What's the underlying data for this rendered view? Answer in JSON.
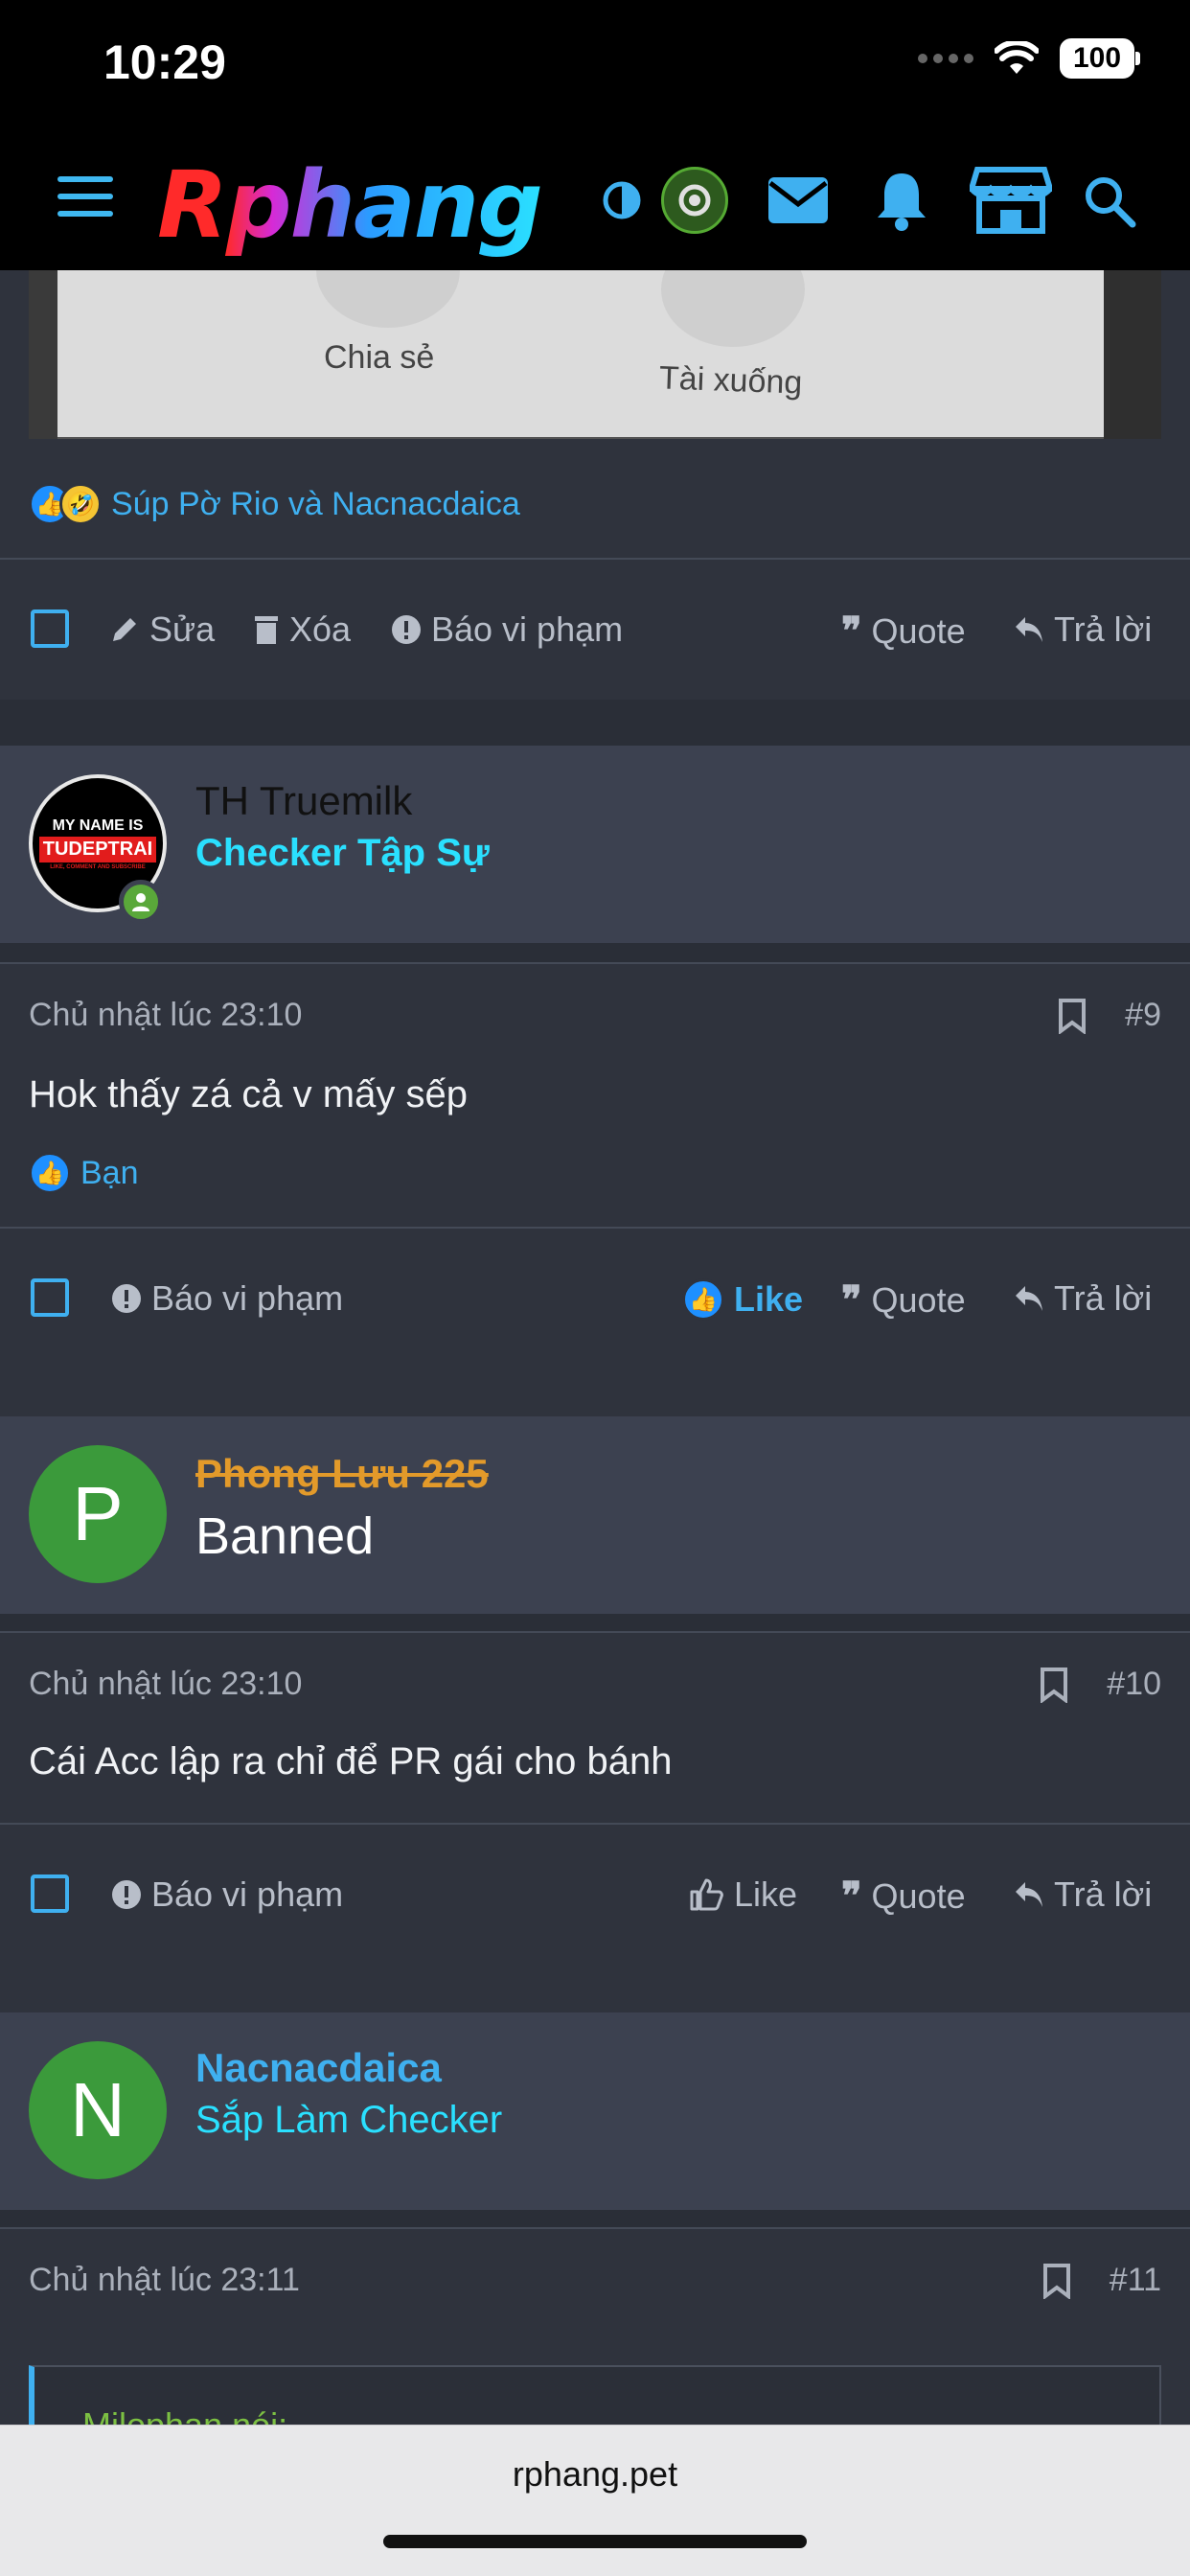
{
  "status_bar": {
    "time": "10:29",
    "battery": "100"
  },
  "header": {
    "logo_text": "Rphang"
  },
  "top_image": {
    "caption_share": "Chia sẻ",
    "caption_download": "Tài xuống"
  },
  "post_prev": {
    "reactions_text": "Súp Pờ Rio và Nacnacdaica",
    "actions": {
      "edit": "Sửa",
      "delete": "Xóa",
      "report": "Báo vi phạm",
      "quote": "Quote",
      "reply": "Trả lời"
    }
  },
  "posts": [
    {
      "author": "TH Truemilk",
      "user_title": "Checker Tập Sự",
      "avatar_text_1": "MY NAME IS",
      "avatar_text_2": "TUDEPTRAI",
      "avatar_text_3": "LIKE, COMMENT AND SUBSCRIBE",
      "timestamp": "Chủ nhật lúc 23:10",
      "post_number": "#9",
      "body": "Hok thấy zá cả v mấy sếp",
      "reactions_text": "Bạn",
      "actions": {
        "report": "Báo vi phạm",
        "like": "Like",
        "quote": "Quote",
        "reply": "Trả lời"
      }
    },
    {
      "author": "Phong Lưu 225",
      "user_title": "Banned",
      "avatar_letter": "P",
      "timestamp": "Chủ nhật lúc 23:10",
      "post_number": "#10",
      "body": "Cái Acc lập ra chỉ để PR gái cho bánh",
      "actions": {
        "report": "Báo vi phạm",
        "like": "Like",
        "quote": "Quote",
        "reply": "Trả lời"
      }
    },
    {
      "author": "Nacnacdaica",
      "user_title": "Sắp Làm Checker",
      "avatar_letter": "N",
      "timestamp": "Chủ nhật lúc 23:11",
      "post_number": "#11",
      "quote_attribution": "Milophan nói:"
    }
  ],
  "browser": {
    "url": "rphang.pet"
  },
  "colors": {
    "accent": "#3fb0f0",
    "cyan": "#2ae0ff",
    "banned_orange": "#e39a2a",
    "avatar_green": "#3b9a3b"
  }
}
